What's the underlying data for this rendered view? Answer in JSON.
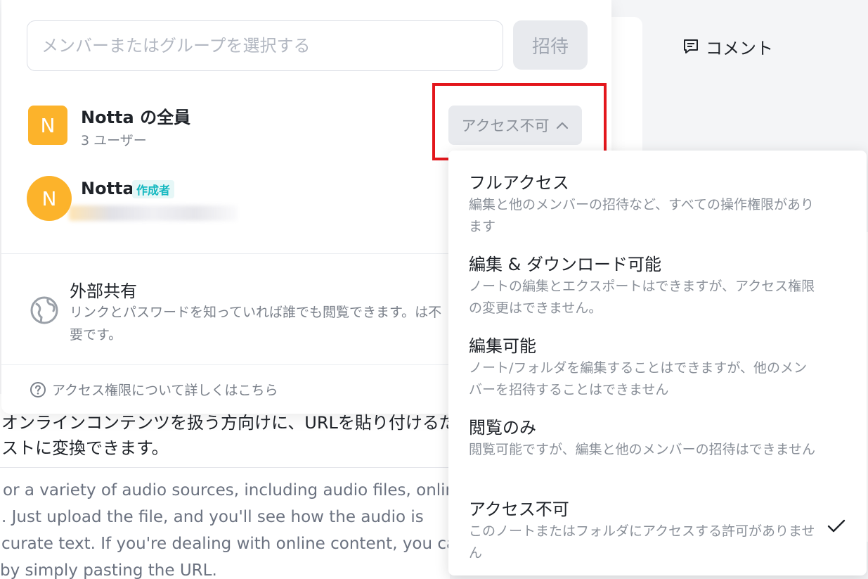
{
  "background": {
    "comment_tab": "コメント",
    "doc_jp_line1": "オンラインコンテンツを扱う方向けに、URLを貼り付けるだ",
    "doc_jp_line2": "ストに変換できます。",
    "doc_en_line1": "or a variety of audio sources, including audio files, online",
    "doc_en_line2": ". Just upload the file, and you'll see how the audio is",
    "doc_en_line3": "curate text. If you're dealing with online content, you can",
    "doc_en_line4": "by simply pasting the URL."
  },
  "share": {
    "member_input_placeholder": "メンバーまたはグループを選択する",
    "invite_label": "招待",
    "everyone": {
      "avatar_letter": "N",
      "name": "Notta の全員",
      "sub": "3 ユーザー",
      "access_label": "アクセス不可"
    },
    "creator": {
      "avatar_letter": "N",
      "name": "Notta",
      "badge": "作成者"
    },
    "external": {
      "title": "外部共有",
      "desc": "リンクとパスワードを知っていれば誰でも閲覧できます。は不要です。"
    },
    "help_link": "アクセス権限について詳しくはこちら"
  },
  "dropdown": {
    "options": [
      {
        "title": "フルアクセス",
        "desc": "編集と他のメンバーの招待など、すべての操作権限があります"
      },
      {
        "title": "編集 & ダウンロード可能",
        "desc": "ノートの編集とエクスポートはできますが、アクセス権限の変更はできません。"
      },
      {
        "title": "編集可能",
        "desc": "ノート/フォルダを編集することはできますが、他のメンバーを招待することはできません"
      },
      {
        "title": "閲覧のみ",
        "desc": "閲覧可能ですが、編集と他のメンバーの招待はできません"
      },
      {
        "title": "アクセス不可",
        "desc": "このノートまたはフォルダにアクセスする許可がありません",
        "selected": true
      }
    ]
  },
  "colors": {
    "avatar": "#fcb32b",
    "highlight": "#e3161c",
    "badge_text": "#14b8c0"
  }
}
